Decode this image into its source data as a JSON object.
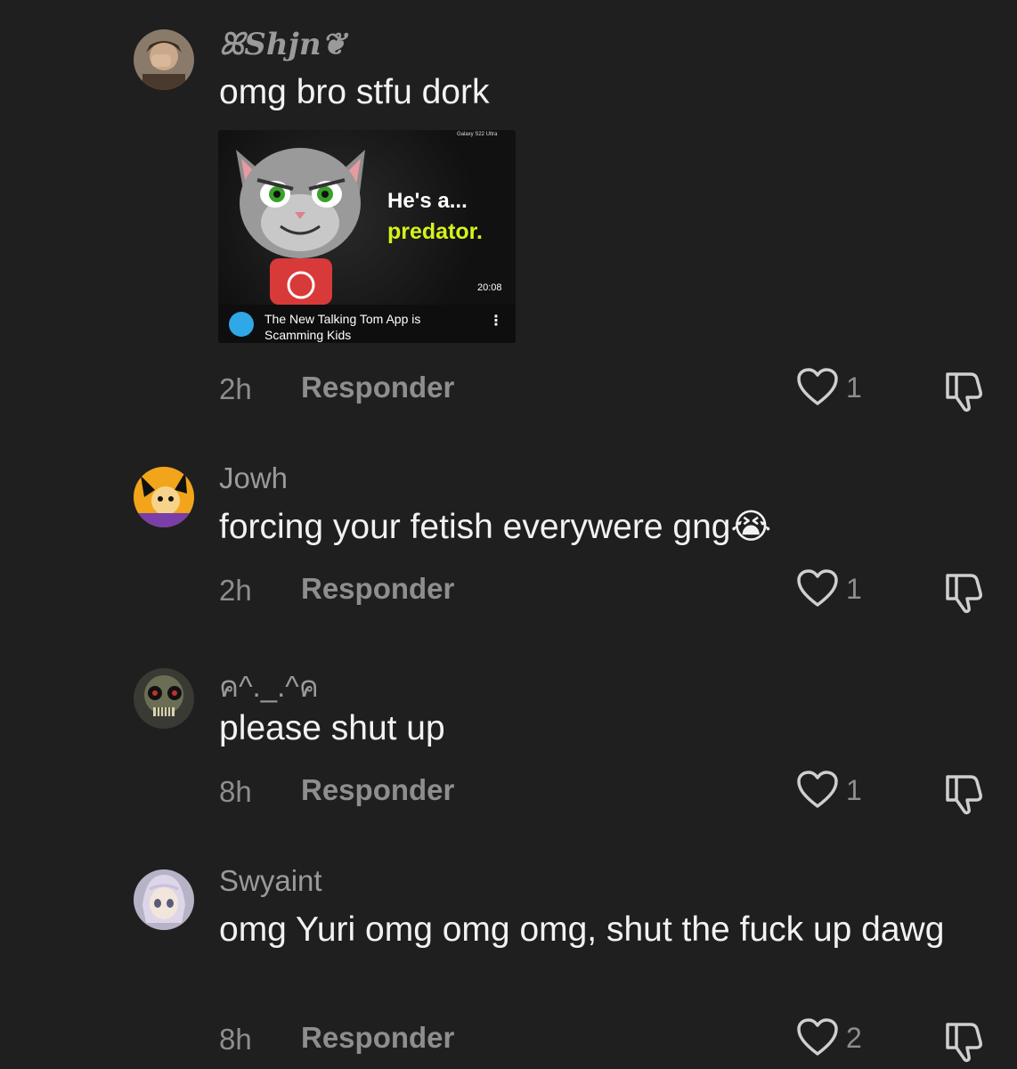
{
  "comments": [
    {
      "username": "ꕤShjn❦",
      "text": "omg bro stfu dork",
      "time": "2h",
      "reply_label": "Responder",
      "likes": "1",
      "video": {
        "tagline": "Galaxy S22 Ultra",
        "headline_line1": "He's a...",
        "headline_line2": "predator.",
        "duration": "20:08",
        "title": "The New Talking Tom App is Scamming Kids"
      }
    },
    {
      "username": "Jowh",
      "text": "forcing your fetish everywere gng😭",
      "time": "2h",
      "reply_label": "Responder",
      "likes": "1"
    },
    {
      "username": "ค^._.^ค",
      "text": "please shut up",
      "time": "8h",
      "reply_label": "Responder",
      "likes": "1"
    },
    {
      "username": "Swyaint",
      "text": "omg Yuri omg omg omg, shut the fuck up dawg",
      "time": "8h",
      "reply_label": "Responder",
      "likes": "2"
    }
  ],
  "colors": {
    "background": "#1f1f1f",
    "muted_text": "#8e8e8e",
    "highlight_yellow": "#d7f21a"
  },
  "icons": [
    "heart-icon",
    "dislike-icon",
    "more-vertical-icon"
  ]
}
